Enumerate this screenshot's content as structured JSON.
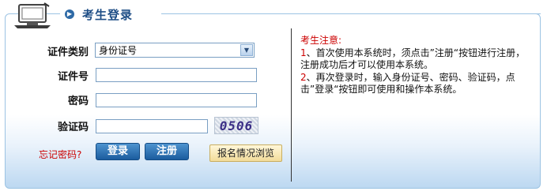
{
  "header": {
    "title": "考生登录"
  },
  "form": {
    "id_type_label": "证件类别",
    "id_type_value": "身份证号",
    "id_number_label": "证件号",
    "id_number_value": "",
    "password_label": "密码",
    "password_value": "",
    "captcha_label": "验证码",
    "captcha_value": "",
    "captcha_text": "0506",
    "forgot_label": "忘记密码?",
    "login_label": "登录",
    "register_label": "注册",
    "browse_label": "报名情况浏览"
  },
  "notice": {
    "title": "考生注意:",
    "items": [
      {
        "num": "1",
        "text": "、首次使用本系统时，须点击”注册“按钮进行注册，注册成功后才可以使用本系统。"
      },
      {
        "num": "2",
        "text": "、再次登录时，输入身份证号、密码、验证码，点击”登录“按钮即可使用和操作本系统。"
      }
    ]
  },
  "colors": {
    "accent": "#1f4e86",
    "warning": "#cc0000",
    "border": "#9cc3e3"
  }
}
